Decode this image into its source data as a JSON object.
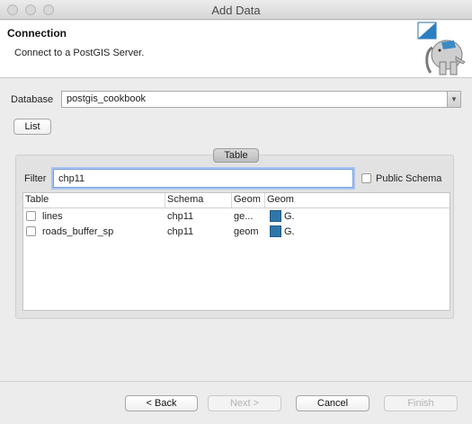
{
  "window": {
    "title": "Add Data"
  },
  "header": {
    "title": "Connection",
    "description": "Connect to a PostGIS Server."
  },
  "database": {
    "label": "Database",
    "selected": "postgis_cookbook"
  },
  "list_button": "List",
  "table_group": {
    "title": "Table",
    "filter_label": "Filter",
    "filter_value": "chp11",
    "public_schema_label": "Public Schema",
    "public_schema_checked": false,
    "columns": [
      "Table",
      "Schema",
      "Geom",
      "Geom"
    ],
    "rows": [
      {
        "table": "lines",
        "schema": "chp11",
        "geom": "ge...",
        "geom_type": "G.",
        "checked": false
      },
      {
        "table": "roads_buffer_sp",
        "schema": "chp11",
        "geom": "geom",
        "geom_type": "G.",
        "checked": false
      }
    ]
  },
  "footer": {
    "back": "< Back",
    "next": "Next >",
    "cancel": "Cancel",
    "finish": "Finish"
  },
  "colors": {
    "geom_swatch": "#2f77a9",
    "focus": "#7a9fd9"
  }
}
